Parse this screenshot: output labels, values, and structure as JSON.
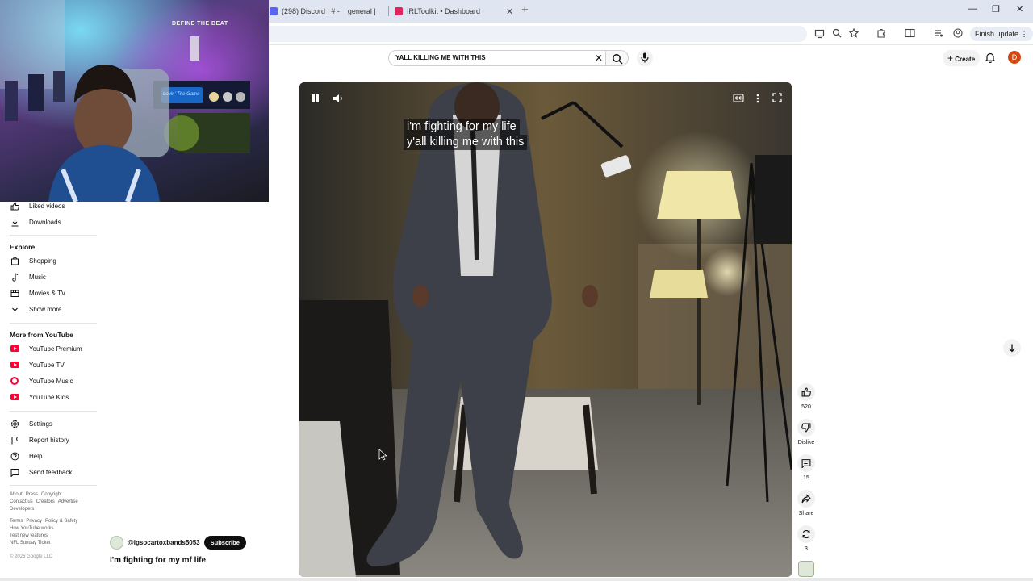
{
  "browser": {
    "tabs": [
      {
        "label": "(298) Discord | # -",
        "color": "#5865f2"
      },
      {
        "label": "general |",
        "color": ""
      },
      {
        "label": "IRLToolkit • Dashboard",
        "color": "#e0245e"
      }
    ],
    "finish_update_label": "Finish update"
  },
  "header": {
    "search_query": "YALL KILLING ME WITH THIS",
    "create_label": "Create",
    "avatar_initial": "D"
  },
  "sidebar": {
    "top_items": [
      {
        "label": "Liked videos",
        "icon": "thumb-up-icon"
      },
      {
        "label": "Downloads",
        "icon": "download-icon"
      }
    ],
    "explore_heading": "Explore",
    "explore_items": [
      {
        "label": "Shopping",
        "icon": "shopping-bag-icon"
      },
      {
        "label": "Music",
        "icon": "music-note-icon"
      },
      {
        "label": "Movies & TV",
        "icon": "film-icon"
      },
      {
        "label": "Show more",
        "icon": "chevron-down-icon"
      }
    ],
    "more_heading": "More from YouTube",
    "more_items": [
      {
        "label": "YouTube Premium",
        "icon": "youtube-premium-icon"
      },
      {
        "label": "YouTube TV",
        "icon": "youtube-tv-icon"
      },
      {
        "label": "YouTube Music",
        "icon": "youtube-music-icon"
      },
      {
        "label": "YouTube Kids",
        "icon": "youtube-kids-icon"
      }
    ],
    "settings_items": [
      {
        "label": "Settings",
        "icon": "gear-icon"
      },
      {
        "label": "Report history",
        "icon": "flag-icon"
      },
      {
        "label": "Help",
        "icon": "help-icon"
      },
      {
        "label": "Send feedback",
        "icon": "feedback-icon"
      }
    ],
    "footer": {
      "row1": [
        "About",
        "Press",
        "Copyright"
      ],
      "row2": [
        "Contact us",
        "Creators",
        "Advertise"
      ],
      "row3": [
        "Developers"
      ],
      "row4": [
        "Terms",
        "Privacy",
        "Policy & Safety"
      ],
      "row5": [
        "How YouTube works"
      ],
      "row6": [
        "Test new features"
      ],
      "row7": [
        "NFL Sunday Ticket"
      ],
      "copyright": "© 2026 Google LLC"
    }
  },
  "webcam": {
    "sign_text": "DEFINE THE BEAT",
    "neon_text": "Lovin' The Game"
  },
  "video": {
    "caption_line1": "i'm fighting for my life",
    "caption_line2": "y'all killing me with this"
  },
  "actions": {
    "like_count": "520",
    "dislike_label": "Dislike",
    "comment_count": "15",
    "share_label": "Share",
    "remix_count": "3"
  },
  "short": {
    "channel_handle": "@igsocartoxbands5053",
    "subscribe_label": "Subscribe",
    "title": "I'm fighting for my mf life"
  }
}
